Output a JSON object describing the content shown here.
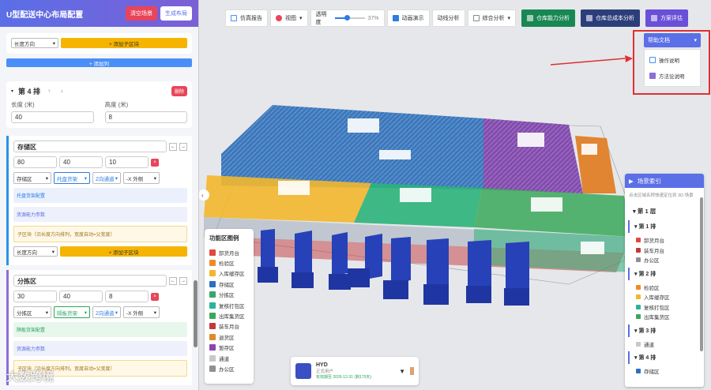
{
  "left": {
    "title": "U型配送中心布局配置",
    "clear_label": "清空场景",
    "generate_label": "生成布局",
    "top_row": {
      "dir": "长度方向",
      "add_sub": "+ 添加子区块"
    },
    "add_col": "+ 添加列",
    "row4": {
      "title": "第 4 排",
      "delete": "删除",
      "length_label": "长度 (米)",
      "length": "40",
      "height_label": "高度 (米)",
      "height": "8"
    },
    "zone1": {
      "name": "存储区",
      "v1": "80",
      "v2": "40",
      "v3": "10",
      "type": "存储区",
      "shelf": "托盘货架",
      "channel": "Z向通道",
      "dir": "-X 外侧",
      "bar1": "托盘货架配置",
      "bar2": "资源能力参数",
      "bar3": "子区块（沿长度方向排列，宽度自动=父宽度）",
      "add": "+ 添加子区块",
      "dirsel": "长度方向"
    },
    "zone2": {
      "name": "分拣区",
      "v1": "30",
      "v2": "40",
      "v3": "8",
      "type": "分拣区",
      "shelf": "隔板货架",
      "channel": "Z向通道",
      "dir": "-X 外侧",
      "bar1": "隔板货架配置",
      "bar2": "资源能力参数",
      "bar3": "子区块（沿长度方向排列，宽度自动=父宽度）"
    }
  },
  "toolbar": {
    "report": "仿真报告",
    "view": "视图",
    "opacity": "透明度",
    "opacity_val": "37%",
    "anim": "动画演示",
    "flow": "动线分析",
    "analysis": "综合分析",
    "cap": "仓库能力分析",
    "cost": "仓库总成本分析",
    "eval": "方案评估"
  },
  "help": {
    "title": "帮助文档",
    "items": [
      "操作说明",
      "方法论说明"
    ]
  },
  "legend": {
    "title": "功能区图例",
    "items": [
      {
        "label": "卸货月台",
        "color": "#e04a3a"
      },
      {
        "label": "检验区",
        "color": "#f08a2a"
      },
      {
        "label": "入库缓存区",
        "color": "#f2b72c"
      },
      {
        "label": "存储区",
        "color": "#2d6fc0"
      },
      {
        "label": "分拣区",
        "color": "#38a86a"
      },
      {
        "label": "复核打包区",
        "color": "#2bb39a"
      },
      {
        "label": "出库集货区",
        "color": "#3aa85a"
      },
      {
        "label": "装车月台",
        "color": "#c23a3a"
      },
      {
        "label": "退货区",
        "color": "#e08a2a"
      },
      {
        "label": "暂存区",
        "color": "#8e44ad"
      },
      {
        "label": "通道",
        "color": "#c8c8c8"
      },
      {
        "label": "办公区",
        "color": "#909090"
      }
    ]
  },
  "index": {
    "title": "场景索引",
    "sub": "点击区域名称快速定位到 3D 场景",
    "floor": "第 1 层",
    "groups": [
      {
        "name": "第 1 排",
        "items": [
          {
            "label": "卸货月台",
            "color": "#e04a3a"
          },
          {
            "label": "装车月台",
            "color": "#c23a3a"
          },
          {
            "label": "办公区",
            "color": "#909090"
          }
        ]
      },
      {
        "name": "第 2 排",
        "items": [
          {
            "label": "检验区",
            "color": "#f08a2a"
          },
          {
            "label": "入库缓存区",
            "color": "#f2b72c"
          },
          {
            "label": "复核打包区",
            "color": "#2bb39a"
          },
          {
            "label": "出库集货区",
            "color": "#3aa85a"
          }
        ]
      },
      {
        "name": "第 3 排",
        "items": [
          {
            "label": "通道",
            "color": "#c8c8c8"
          }
        ]
      },
      {
        "name": "第 4 排",
        "items": [
          {
            "label": "存储区",
            "color": "#2d6fc0"
          }
        ]
      }
    ]
  },
  "bottom": {
    "name": "HYD",
    "role": "正式用户",
    "expire": "有效期至 2026-12-31 (剩175天)"
  },
  "watermark": "大数跨境"
}
